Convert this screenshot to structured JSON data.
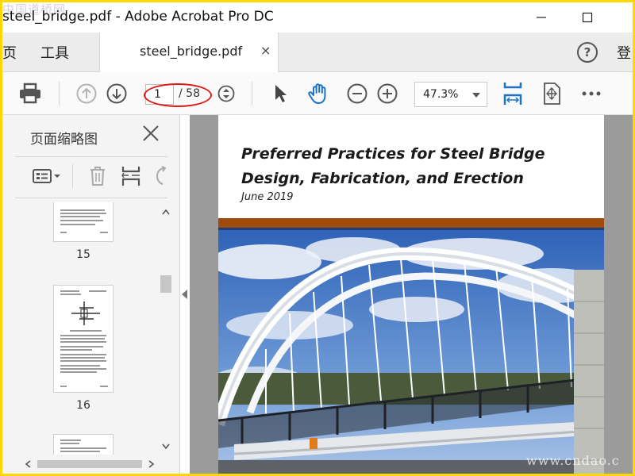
{
  "window": {
    "title": "steel_bridge.pdf - Adobe Acrobat Pro DC",
    "watermark": "中国道桥网",
    "site_mark": "www.cndao.c"
  },
  "tabs": {
    "home_partial": "页",
    "tools": "工具",
    "document_tab": "steel_bridge.pdf",
    "close_symbol": "×",
    "help_symbol": "?",
    "login_partial": "登"
  },
  "toolbar": {
    "current_page": "1",
    "total_pages": "/ 58",
    "zoom": "47.3%"
  },
  "thumbnails_panel": {
    "title": "页面缩略图",
    "pages": [
      {
        "label": "15"
      },
      {
        "label": "16"
      }
    ]
  },
  "document": {
    "title": "Preferred Practices for Steel Bridge Design, Fabrication, and Erection",
    "date": "June 2019"
  },
  "colors": {
    "accent_blue": "#1a73c8",
    "band_brown": "#a04a0b",
    "band_blue": "#1e3e78",
    "annotation_red": "#e01818"
  }
}
